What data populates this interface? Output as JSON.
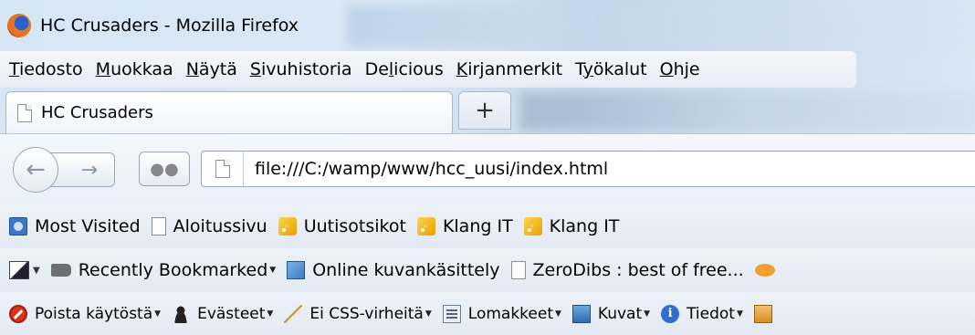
{
  "window": {
    "title": "HC Crusaders - Mozilla Firefox"
  },
  "menu": {
    "items": [
      {
        "pre": "",
        "u": "T",
        "post": "iedosto"
      },
      {
        "pre": "",
        "u": "M",
        "post": "uokkaa"
      },
      {
        "pre": "",
        "u": "N",
        "post": "äytä"
      },
      {
        "pre": "",
        "u": "S",
        "post": "ivuhistoria"
      },
      {
        "pre": "De",
        "u": "l",
        "post": "icious"
      },
      {
        "pre": "",
        "u": "K",
        "post": "irjanmerkit"
      },
      {
        "pre": "T",
        "u": "y",
        "post": "ökalut"
      },
      {
        "pre": "",
        "u": "O",
        "post": "hje"
      }
    ]
  },
  "tabs": {
    "active_label": "HC Crusaders",
    "new_tab_label": "+"
  },
  "nav": {
    "back_glyph": "←",
    "forward_glyph": "→",
    "url": "file:///C:/wamp/www/hcc_uusi/index.html"
  },
  "bookmarks_bar": {
    "items": [
      {
        "label": "Most Visited",
        "icon": "most-visited-icon"
      },
      {
        "label": "Aloitussivu",
        "icon": "page-icon"
      },
      {
        "label": "Uutisotsikot",
        "icon": "rss-icon"
      },
      {
        "label": "Klang IT",
        "icon": "rss-icon"
      },
      {
        "label": "Klang IT",
        "icon": "rss-icon"
      }
    ]
  },
  "bookmarks_bar_2": {
    "items": [
      {
        "label": "Recently Bookmarked",
        "icon": "tag-icon"
      },
      {
        "label": "Online kuvankäsittely",
        "icon": "image-editor-icon"
      },
      {
        "label": "ZeroDibs : best of free...",
        "icon": "page-icon"
      }
    ]
  },
  "webdev_bar": {
    "items": [
      {
        "label": "Poista käytöstä",
        "icon": "disable-icon"
      },
      {
        "label": "Evästeet",
        "icon": "cookies-icon"
      },
      {
        "label": "Ei CSS-virheitä",
        "icon": "css-wand-icon"
      },
      {
        "label": "Lomakkeet",
        "icon": "forms-icon"
      },
      {
        "label": "Kuvat",
        "icon": "images-icon"
      },
      {
        "label": "Tiedot",
        "icon": "info-icon"
      }
    ]
  }
}
